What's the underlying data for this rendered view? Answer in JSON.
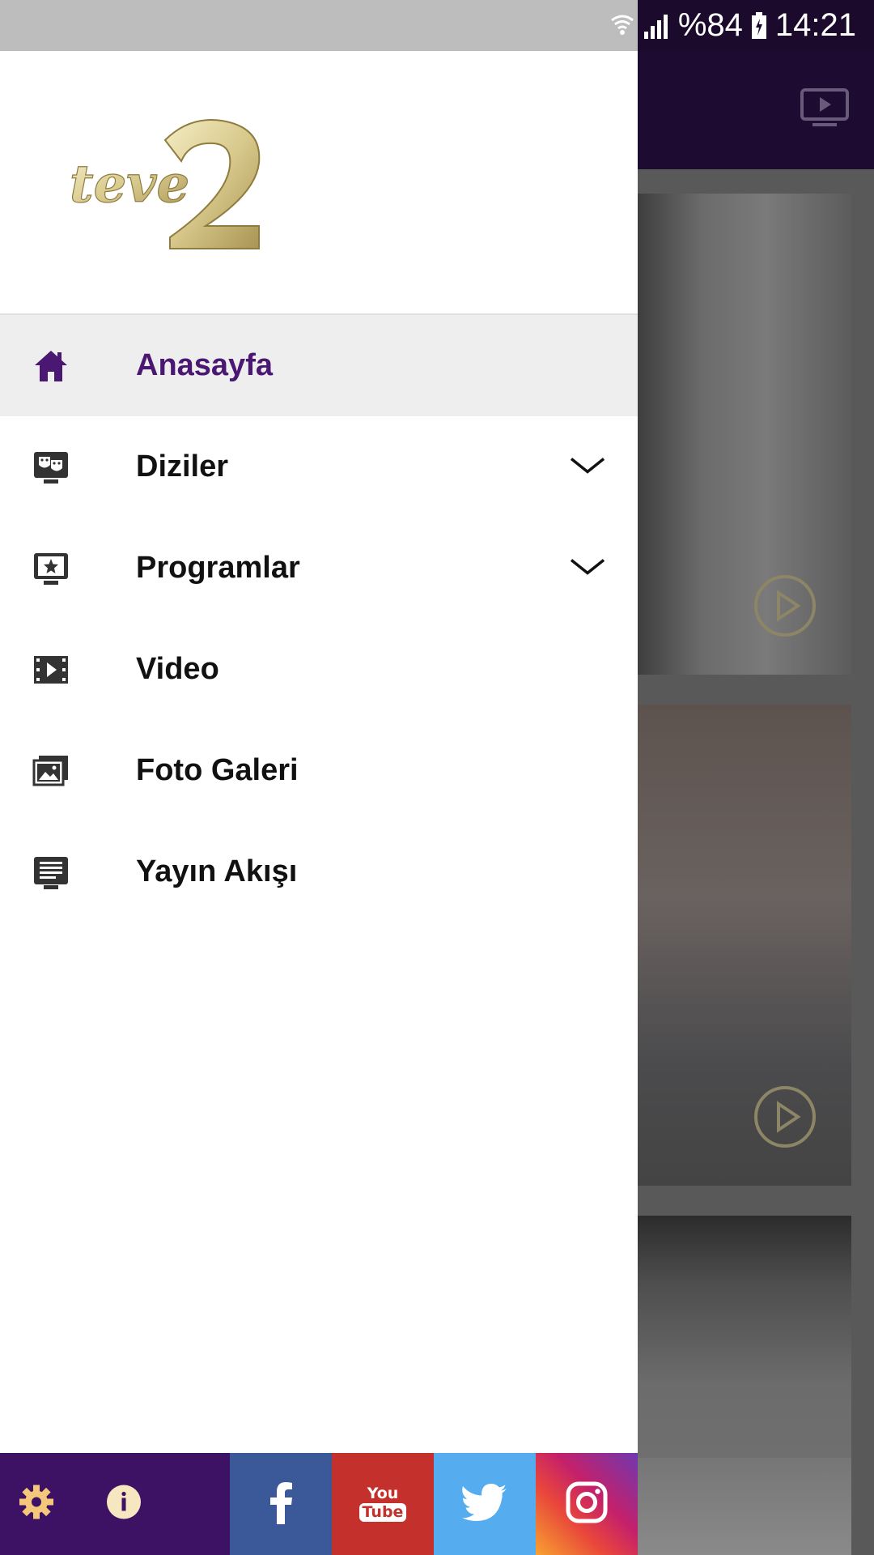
{
  "status_bar": {
    "battery": "%84",
    "time": "14:21"
  },
  "drawer": {
    "logo_alt": "teve2",
    "menu": [
      {
        "label": "Anasayfa",
        "icon": "home-icon",
        "active": true,
        "expandable": false
      },
      {
        "label": "Diziler",
        "icon": "drama-masks-icon",
        "active": false,
        "expandable": true
      },
      {
        "label": "Programlar",
        "icon": "star-screen-icon",
        "active": false,
        "expandable": true
      },
      {
        "label": "Video",
        "icon": "film-icon",
        "active": false,
        "expandable": false
      },
      {
        "label": "Foto Galeri",
        "icon": "image-icon",
        "active": false,
        "expandable": false
      },
      {
        "label": "Yayın Akışı",
        "icon": "schedule-list-icon",
        "active": false,
        "expandable": false
      }
    ]
  },
  "bottom_bar": {
    "settings_icon": "gear-icon",
    "info_icon": "info-icon",
    "social": [
      {
        "name": "facebook",
        "icon": "facebook-icon"
      },
      {
        "name": "youtube",
        "icon": "youtube-icon",
        "text_top": "You",
        "text_bottom": "Tube"
      },
      {
        "name": "twitter",
        "icon": "twitter-icon"
      },
      {
        "name": "instagram",
        "icon": "instagram-icon"
      }
    ]
  },
  "colors": {
    "accent_purple": "#4a1772",
    "drawer_bottom": "#3d1163",
    "facebook": "#3b5998",
    "youtube": "#c4302b",
    "twitter": "#55acee"
  }
}
